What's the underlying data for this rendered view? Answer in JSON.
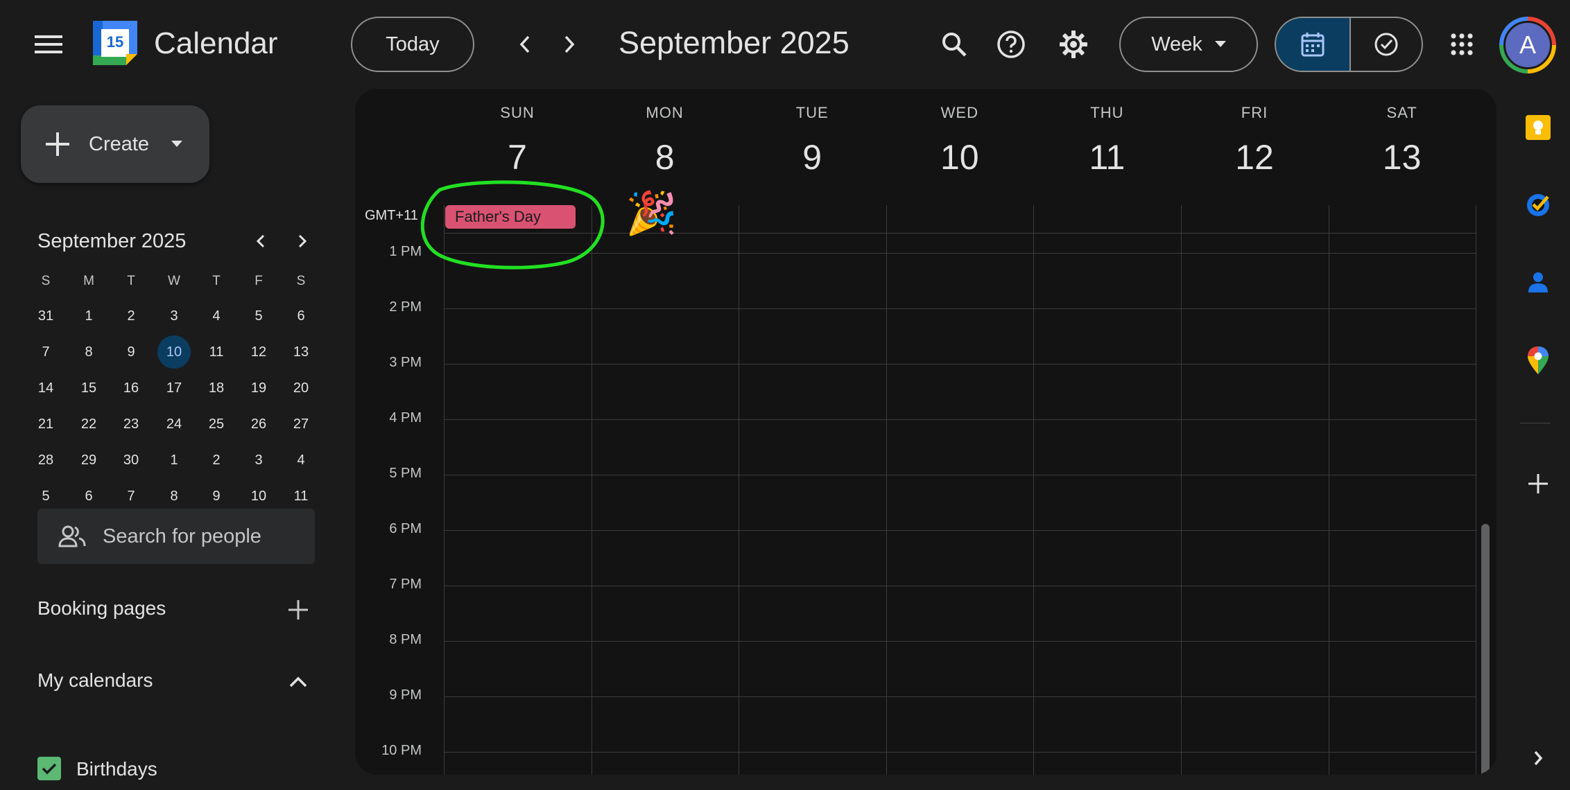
{
  "header": {
    "app_title": "Calendar",
    "logo_day": "15",
    "today_label": "Today",
    "current_period": "September 2025",
    "view_label": "Week",
    "avatar_letter": "A"
  },
  "sidebar": {
    "create_label": "Create",
    "mini_calendar": {
      "title": "September 2025",
      "weekday_headers": [
        "S",
        "M",
        "T",
        "W",
        "T",
        "F",
        "S"
      ],
      "weeks": [
        [
          "31",
          "1",
          "2",
          "3",
          "4",
          "5",
          "6"
        ],
        [
          "7",
          "8",
          "9",
          "10",
          "11",
          "12",
          "13"
        ],
        [
          "14",
          "15",
          "16",
          "17",
          "18",
          "19",
          "20"
        ],
        [
          "21",
          "22",
          "23",
          "24",
          "25",
          "26",
          "27"
        ],
        [
          "28",
          "29",
          "30",
          "1",
          "2",
          "3",
          "4"
        ],
        [
          "5",
          "6",
          "7",
          "8",
          "9",
          "10",
          "11"
        ]
      ],
      "today": "10"
    },
    "people_search_placeholder": "Search for people",
    "booking_pages_label": "Booking pages",
    "my_calendars_label": "My calendars",
    "calendars": [
      {
        "name": "Birthdays",
        "checked": true,
        "color": "#5bb974"
      }
    ]
  },
  "week": {
    "timezone": "GMT+11",
    "days": [
      {
        "name": "SUN",
        "num": "7"
      },
      {
        "name": "MON",
        "num": "8"
      },
      {
        "name": "TUE",
        "num": "9"
      },
      {
        "name": "WED",
        "num": "10"
      },
      {
        "name": "THU",
        "num": "11"
      },
      {
        "name": "FRI",
        "num": "12"
      },
      {
        "name": "SAT",
        "num": "13"
      }
    ],
    "hours": [
      "1 PM",
      "2 PM",
      "3 PM",
      "4 PM",
      "5 PM",
      "6 PM",
      "7 PM",
      "8 PM",
      "9 PM",
      "10 PM"
    ],
    "all_day_events": [
      {
        "title": "Father's Day",
        "day": "SUN",
        "color": "#d95272"
      }
    ],
    "decoration": "🎉"
  },
  "rail": {
    "icons": [
      "keep-icon",
      "tasks-icon",
      "contacts-icon",
      "maps-icon",
      "add-icon",
      "expand-icon"
    ]
  },
  "colors": {
    "background": "#1b1b1b",
    "panel": "#131314",
    "accent_selected": "#0b3d60",
    "event": "#d95272",
    "annotation": "#22e022"
  }
}
